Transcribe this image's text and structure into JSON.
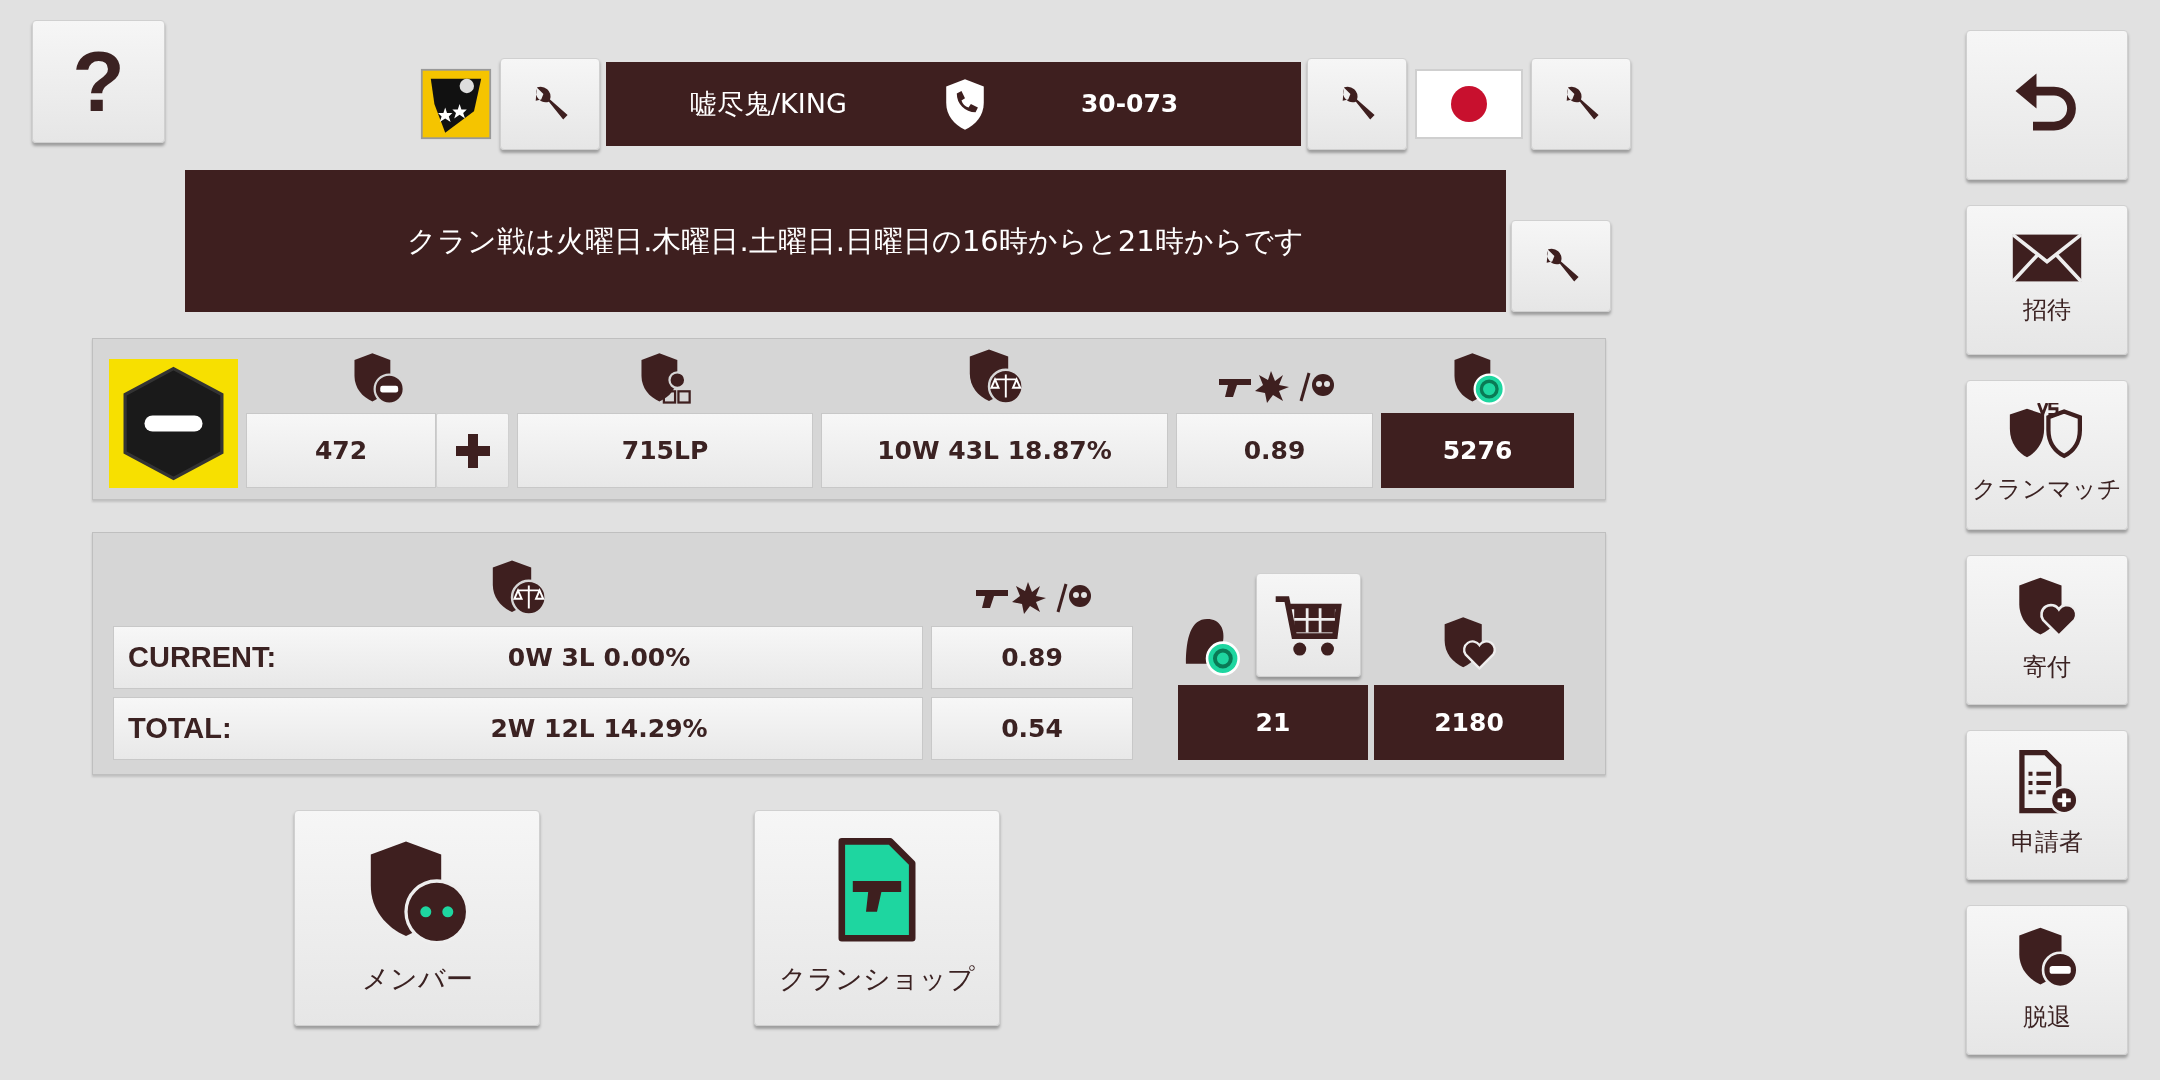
{
  "help_button": {
    "label": "?"
  },
  "clan_header": {
    "name": "嘘尽鬼/KING",
    "code": "30-073"
  },
  "notice": {
    "text": "クラン戦は火曜日.木曜日.土曜日.日曜日の16時からと21時からです"
  },
  "stats": [
    {
      "kind": "exp",
      "value": "472"
    },
    {
      "kind": "league",
      "value": "715LP"
    },
    {
      "kind": "record",
      "value": "10W 43L 18.87%"
    },
    {
      "kind": "kd",
      "value": "0.89"
    },
    {
      "kind": "coins",
      "value": "5276"
    }
  ],
  "season": {
    "rows": [
      {
        "label": "CURRENT:",
        "record": "0W 3L 0.00%",
        "ratio": "0.89"
      },
      {
        "label": "TOTAL:",
        "record": "2W 12L 14.29%",
        "ratio": "0.54"
      }
    ],
    "coins": "21",
    "donations": "2180"
  },
  "bottom_buttons": [
    {
      "kind": "members",
      "label": "メンバー"
    },
    {
      "kind": "shop",
      "label": "クランショップ"
    }
  ],
  "sidebar": [
    {
      "kind": "back"
    },
    {
      "kind": "invite",
      "label": "招待"
    },
    {
      "kind": "match",
      "label": "クランマッチ"
    },
    {
      "kind": "donate",
      "label": "寄付"
    },
    {
      "kind": "applicants",
      "label": "申請者"
    },
    {
      "kind": "leave",
      "label": "脱退"
    }
  ]
}
